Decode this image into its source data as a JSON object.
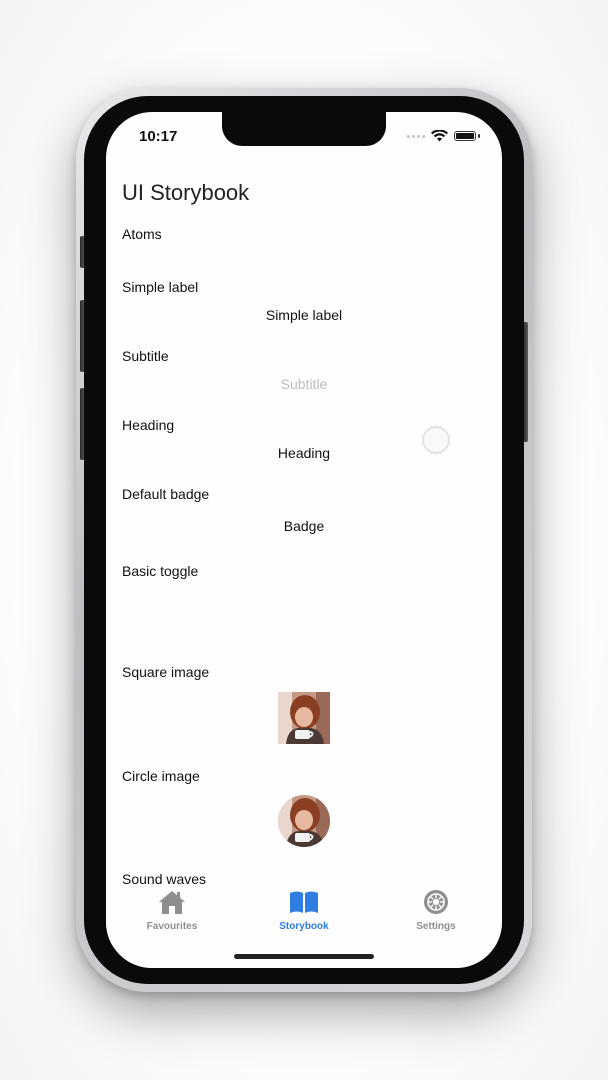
{
  "status_bar": {
    "time": "10:17"
  },
  "page": {
    "title": "UI Storybook"
  },
  "sections": {
    "atoms": "Atoms",
    "simple_label": {
      "label": "Simple label",
      "demo": "Simple label"
    },
    "subtitle": {
      "label": "Subtitle",
      "demo": "Subtitle"
    },
    "heading": {
      "label": "Heading",
      "demo": "Heading"
    },
    "default_badge": {
      "label": "Default badge",
      "demo": "Badge"
    },
    "basic_toggle": {
      "label": "Basic toggle"
    },
    "square_image": {
      "label": "Square image"
    },
    "circle_image": {
      "label": "Circle image"
    },
    "sound_waves": {
      "label": "Sound waves"
    }
  },
  "tabbar": {
    "tabs": [
      {
        "label": "Favourites",
        "icon": "house-icon",
        "active": false
      },
      {
        "label": "Storybook",
        "icon": "book-icon",
        "active": true
      },
      {
        "label": "Settings",
        "icon": "gear-icon",
        "active": false
      }
    ]
  },
  "colors": {
    "accent": "#2f7de1",
    "inactive_tab": "#8e8e8e",
    "subtitle_text": "#bcbcbc"
  }
}
